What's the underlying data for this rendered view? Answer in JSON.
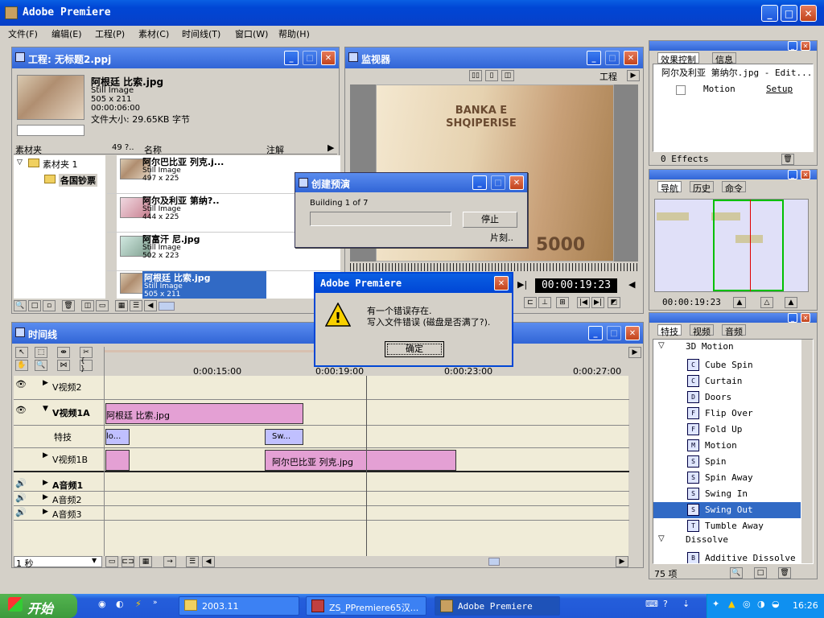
{
  "app": {
    "title": "Adobe Premiere"
  },
  "menu": [
    "文件(F)",
    "编辑(E)",
    "工程(P)",
    "素材(C)",
    "时间线(T)",
    "窗口(W)",
    "帮助(H)"
  ],
  "project": {
    "title": "工程: 无标题2.ppj",
    "preview": {
      "name": "阿根廷 比索.jpg",
      "type": "Still Image",
      "dims": "505 x 211",
      "duration": "00:00:06:00",
      "size": "文件大小: 29.65KB 字节"
    },
    "bins_header": "素材夹",
    "bins": [
      "素材夹 1",
      "各国钞票"
    ],
    "col_count": "49 ?..",
    "col_name": "名称",
    "col_notes": "注解",
    "items": [
      {
        "name": "阿尔巴比亚 列克.j...",
        "type": "Still Image",
        "dims": "497 x 225"
      },
      {
        "name": "阿尔及利亚 第纳?..",
        "type": "Still Image",
        "dims": "444 x 225"
      },
      {
        "name": "阿富汗 尼.jpg",
        "type": "Still Image",
        "dims": "502 x 223"
      },
      {
        "name": "阿根廷 比索.jpg",
        "type": "Still Image",
        "dims": "505 x 211"
      }
    ]
  },
  "monitor": {
    "title": "监视器",
    "project_label": "工程",
    "timecode": "00:00:19:23",
    "banknote_text": "BANKA E SHQIPERISE",
    "denom": "5000"
  },
  "effect_controls": {
    "tabs": [
      "效果控制",
      "信息"
    ],
    "clip": "阿尔及利亚 第纳尔.jpg - Edit...",
    "motion": "Motion",
    "setup": "Setup",
    "count": "0 Effects"
  },
  "navigator": {
    "tabs": [
      "导航",
      "历史",
      "命令"
    ],
    "timecode": "00:00:19:23"
  },
  "effects": {
    "tabs": [
      "特技",
      "视频",
      "音频"
    ],
    "group1": "3D Motion",
    "items": [
      "Cube Spin",
      "Curtain",
      "Doors",
      "Flip Over",
      "Fold Up",
      "Motion",
      "Spin",
      "Spin Away",
      "Swing In",
      "Swing Out",
      "Tumble Away"
    ],
    "selected_index": 9,
    "group2": "Dissolve",
    "item_after": "Additive Dissolve",
    "count": "75 项"
  },
  "timeline": {
    "title": "时间线",
    "ruler": [
      "0:00:15:00",
      "0:00:19:00",
      "0:00:23:00",
      "0:00:27:00"
    ],
    "tracks": {
      "v2": "V视频2",
      "v1a": "V视频1A",
      "fx": "特技",
      "v1b": "V视频1B",
      "a1": "A音频1",
      "a2": "A音频2",
      "a3": "A音频3"
    },
    "clip_v1a": "阿根廷 比索.jpg",
    "clip_fx1": "lo...",
    "clip_fx2": "Sw...",
    "clip_v1b": "阿尔巴比亚 列克.jpg",
    "zoom": "1 秒"
  },
  "render_dialog": {
    "title": "创建预演",
    "status": "Building 1 of 7",
    "progress": 0,
    "stop": "停止",
    "info": "片刻.."
  },
  "error_dialog": {
    "title": "Adobe Premiere",
    "line1": "有一个错误存在.",
    "line2": "写入文件错误 (磁盘是否满了?).",
    "ok": "确定"
  },
  "taskbar": {
    "start": "开始",
    "tasks": [
      "2003.11",
      "ZS_PPremiere65汉...",
      "Adobe Premiere"
    ],
    "clock": "16:26"
  },
  "colors": {
    "xp_blue": "#0046d5",
    "selection": "#316ac5",
    "clip_pink": "#e4a0d4",
    "fx_clip": "#c0c0ff"
  }
}
